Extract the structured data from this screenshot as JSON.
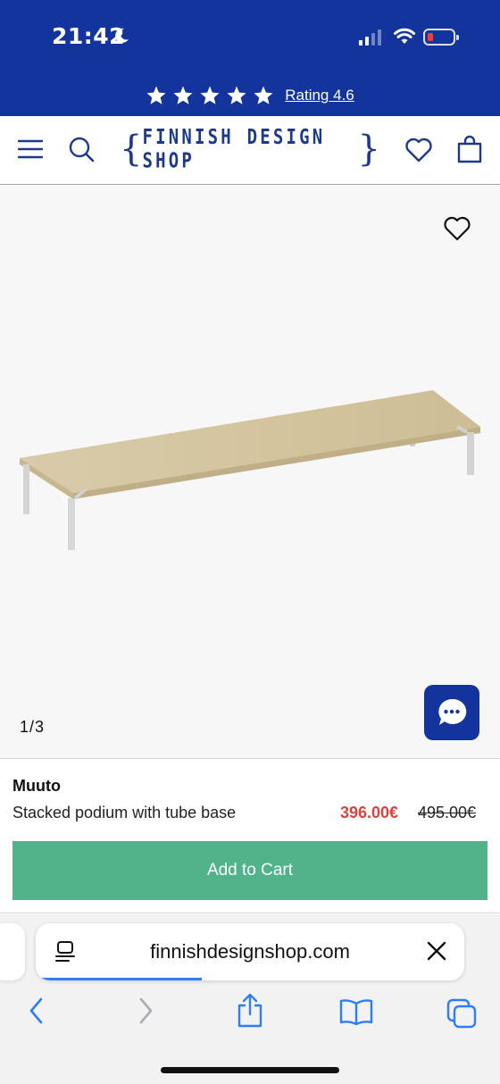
{
  "status": {
    "time": "21:42",
    "icons": [
      "moon-icon",
      "cellular-signal-icon",
      "wifi-icon",
      "battery-low-icon"
    ],
    "battery_color": "#ff3b30"
  },
  "rating_bar": {
    "star_count": 5,
    "link_text": "Rating 4.6",
    "background": "#12349c"
  },
  "header": {
    "logo_text": "FINNISH DESIGN SHOP",
    "icons": [
      "menu-icon",
      "search-icon",
      "heart-icon",
      "shopping-bag-icon"
    ],
    "brand_color": "#1d3a8a"
  },
  "gallery": {
    "image_counter": "1/3",
    "icons": [
      "heart-outline-icon",
      "chat-bubble-icon"
    ]
  },
  "product": {
    "brand": "Muuto",
    "name": "Stacked podium with tube base",
    "price": "396.00€",
    "old_price": "495.00€",
    "add_to_cart_label": "Add to Cart",
    "price_color": "#d9453e",
    "cart_button_color": "#52b28a"
  },
  "browser": {
    "url": "finnishdesignshop.com",
    "toolbar_icons": [
      "back-icon",
      "forward-icon",
      "share-icon",
      "bookmarks-icon",
      "tabs-icon"
    ],
    "accent_color": "#2f7cf6"
  }
}
